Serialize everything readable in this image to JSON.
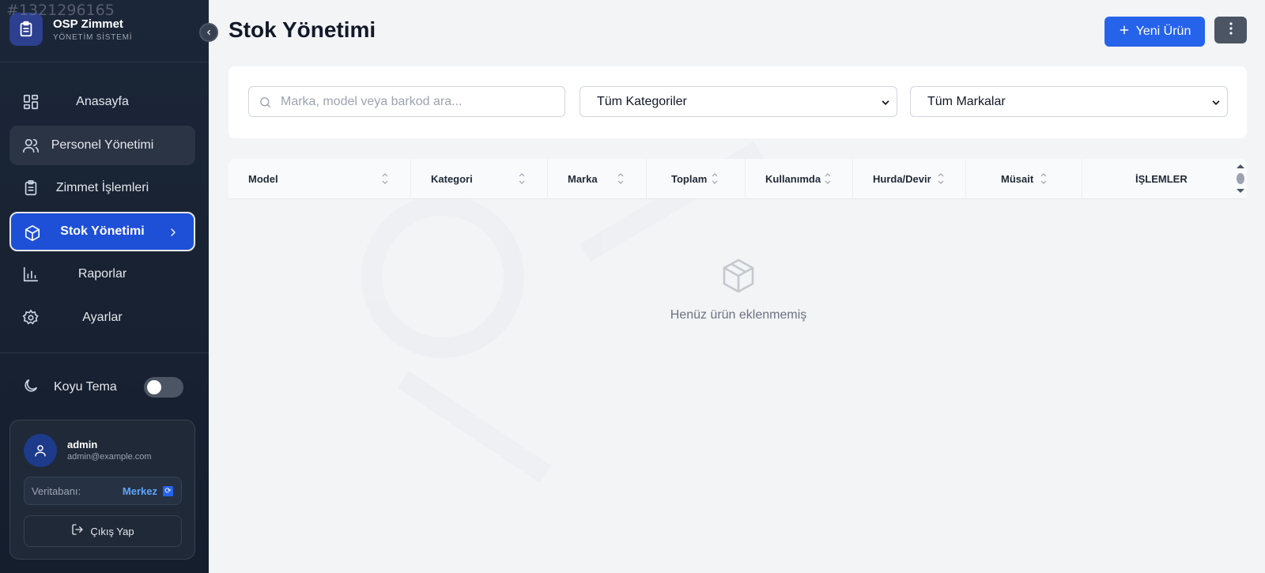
{
  "overlay_id": "#1321296165",
  "app": {
    "name": "OSP Zimmet",
    "subtitle": "YÖNETİM SİSTEMİ"
  },
  "sidebar": {
    "items": [
      {
        "label": "Anasayfa",
        "icon": "dashboard-icon"
      },
      {
        "label": "Personel Yönetimi",
        "icon": "users-icon"
      },
      {
        "label": "Zimmet İşlemleri",
        "icon": "clipboard-icon"
      },
      {
        "label": "Stok Yönetimi",
        "icon": "box-icon",
        "active": true
      },
      {
        "label": "Raporlar",
        "icon": "bar-chart-icon"
      },
      {
        "label": "Ayarlar",
        "icon": "gear-icon"
      }
    ],
    "theme_label": "Koyu Tema",
    "theme_on": false
  },
  "user": {
    "name": "admin",
    "email": "admin@example.com",
    "db_label": "Veritabanı:",
    "db_value": "Merkez",
    "logout_label": "Çıkış Yap"
  },
  "page": {
    "title": "Stok Yönetimi",
    "new_button": "Yeni Ürün"
  },
  "filters": {
    "search_placeholder": "Marka, model veya barkod ara...",
    "category": "Tüm Kategoriler",
    "brand": "Tüm Markalar"
  },
  "table": {
    "columns": [
      "Model",
      "Kategori",
      "Marka",
      "Toplam",
      "Kullanımda",
      "Hurda/Devir",
      "Müsait",
      "İŞLEMLER"
    ],
    "empty_message": "Henüz ürün eklenmemiş"
  },
  "colors": {
    "sidebar_bg": "#1b2638",
    "accent": "#2563eb",
    "active_nav": "#1d4fd7",
    "page_bg": "#f3f4f6"
  }
}
